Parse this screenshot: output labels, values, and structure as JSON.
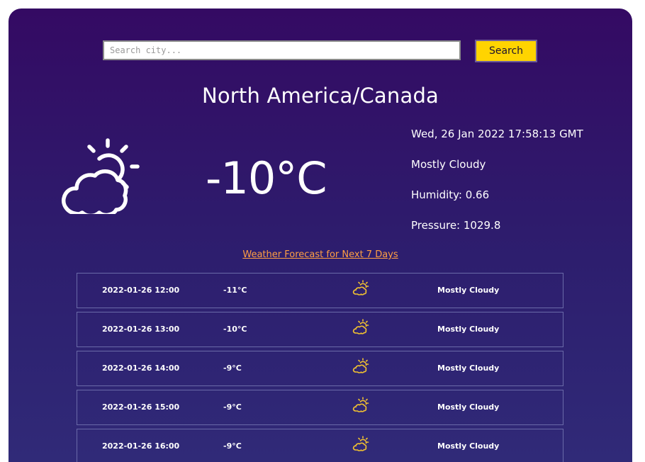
{
  "search": {
    "placeholder": "Search city...",
    "button_label": "Search"
  },
  "current": {
    "location": "North America/Canada",
    "temperature": "-10°C",
    "datetime": "Wed, 26 Jan 2022 17:58:13 GMT",
    "condition": "Mostly Cloudy",
    "humidity": "Humidity: 0.66",
    "pressure": "Pressure: 1029.8",
    "icon": "partly-cloudy-day-icon"
  },
  "forecast": {
    "link_label": "Weather Forecast for Next 7 Days",
    "rows": [
      {
        "date": "2022-01-26 12:00",
        "temp": "-11°C",
        "icon": "partly-cloudy-icon",
        "condition": "Mostly Cloudy"
      },
      {
        "date": "2022-01-26 13:00",
        "temp": "-10°C",
        "icon": "partly-cloudy-icon",
        "condition": "Mostly Cloudy"
      },
      {
        "date": "2022-01-26 14:00",
        "temp": "-9°C",
        "icon": "partly-cloudy-icon",
        "condition": "Mostly Cloudy"
      },
      {
        "date": "2022-01-26 15:00",
        "temp": "-9°C",
        "icon": "partly-cloudy-icon",
        "condition": "Mostly Cloudy"
      },
      {
        "date": "2022-01-26 16:00",
        "temp": "-9°C",
        "icon": "partly-cloudy-icon",
        "condition": "Mostly Cloudy"
      }
    ]
  },
  "colors": {
    "background_top": "#340a63",
    "background_bottom": "#302a78",
    "search_button": "#ffd400",
    "link": "#ff9f43",
    "icon_accent": "#f2c230"
  }
}
